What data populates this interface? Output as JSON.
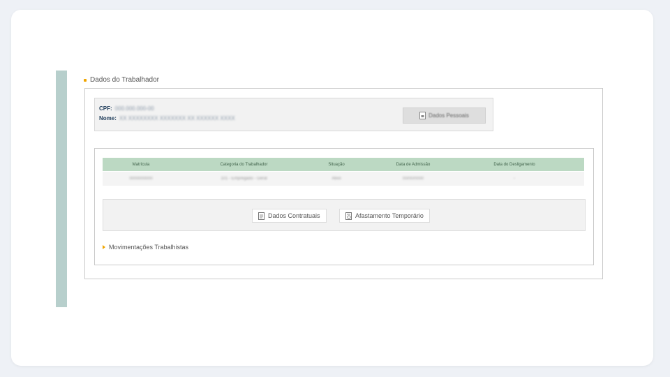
{
  "section": {
    "title": "Dados do Trabalhador"
  },
  "worker": {
    "cpf_label": "CPF:",
    "cpf_value": "000.000.000-00",
    "nome_label": "Nome:",
    "nome_value": "XX XXXXXXXX XXXXXXX XX XXXXXX XXXX",
    "dados_pessoais_label": "Dados Pessoais"
  },
  "table": {
    "headers": [
      "Matrícula",
      "Categoria do Trabalhador",
      "Situação",
      "Data de Admissão",
      "Data do Desligamento"
    ],
    "row": [
      "0000000000",
      "101 - Empregado - Geral",
      "Ativo",
      "00/00/0000",
      "-"
    ]
  },
  "actions": {
    "dados_contratuais": "Dados Contratuais",
    "afastamento_temporario": "Afastamento Temporário"
  },
  "movimentacoes": {
    "label": "Movimentações Trabalhistas"
  },
  "colors": {
    "accent": "#f0a500",
    "table_header": "#bcd9c3",
    "sidebar": "#b7cfcc"
  }
}
